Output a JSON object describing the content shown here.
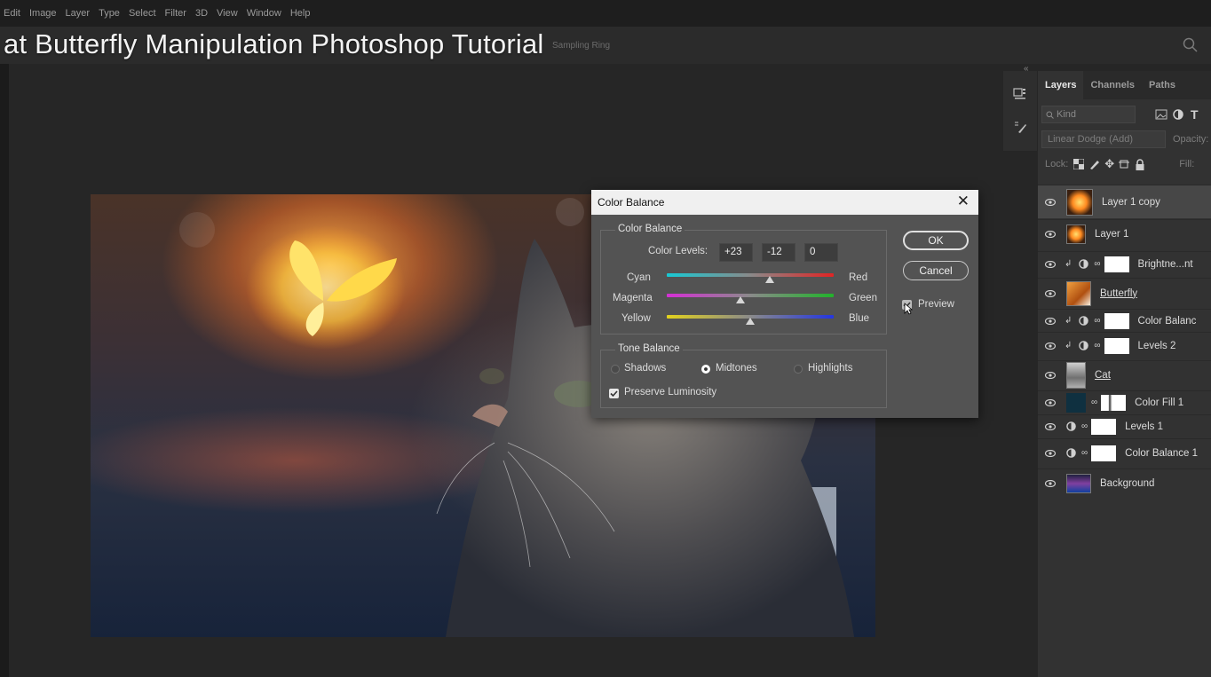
{
  "menu": {
    "items": [
      "Edit",
      "Image",
      "Layer",
      "Type",
      "Select",
      "Filter",
      "3D",
      "View",
      "Window",
      "Help"
    ]
  },
  "options": {
    "hint": "Sampling Ring"
  },
  "video_title": "at Butterfly Manipulation Photoshop Tutorial",
  "dialog": {
    "title": "Color Balance",
    "color_balance_group": "Color Balance",
    "color_levels_label": "Color Levels:",
    "levels": [
      "+23",
      "-12",
      "0"
    ],
    "sliders": [
      {
        "left": "Cyan",
        "right": "Red",
        "value": 23,
        "left_color": "#17c9d4",
        "right_color": "#e02424"
      },
      {
        "left": "Magenta",
        "right": "Green",
        "value": -12,
        "left_color": "#d62fd6",
        "right_color": "#22b22b"
      },
      {
        "left": "Yellow",
        "right": "Blue",
        "value": 0,
        "left_color": "#e2d21c",
        "right_color": "#2436e0"
      }
    ],
    "tone_balance_group": "Tone Balance",
    "tones": [
      "Shadows",
      "Midtones",
      "Highlights"
    ],
    "selected_tone": "Midtones",
    "preserve_luminosity": "Preserve Luminosity",
    "buttons": {
      "ok": "OK",
      "cancel": "Cancel"
    },
    "preview_label": "Preview"
  },
  "panel": {
    "tabs": [
      "Layers",
      "Channels",
      "Paths"
    ],
    "kind_placeholder": "Kind",
    "blend_mode": "Linear Dodge (Add)",
    "opacity_label": "Opacity:",
    "lock_label": "Lock:",
    "fill_label": "Fill:",
    "layers": [
      {
        "name": "Layer 1 copy",
        "kind": "glow",
        "selected": true
      },
      {
        "name": "Layer 1",
        "kind": "glow"
      },
      {
        "name": "Brightne...nt",
        "kind": "adjust-clip"
      },
      {
        "name": "Butterfly",
        "kind": "butterfly",
        "underline": true
      },
      {
        "name": "Color Balanc",
        "kind": "adjust-clip"
      },
      {
        "name": "Levels 2",
        "kind": "adjust-clip"
      },
      {
        "name": "Cat",
        "kind": "cat",
        "underline": true
      },
      {
        "name": "Color Fill 1",
        "kind": "fill"
      },
      {
        "name": "Levels 1",
        "kind": "adjust"
      },
      {
        "name": "Color Balance 1",
        "kind": "adjust"
      },
      {
        "name": "Background",
        "kind": "bg"
      }
    ]
  }
}
